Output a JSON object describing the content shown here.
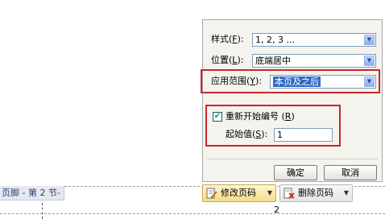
{
  "dialog": {
    "style_label": "样式",
    "style_key": "F",
    "style_value": "1, 2, 3 ...",
    "position_label": "位置",
    "position_key": "L",
    "position_value": "底端居中",
    "apply_label": "应用范围",
    "apply_key": "Y",
    "apply_value": "本页及之后",
    "restart_label": "重新开始编号",
    "restart_key": "R",
    "restart_checked": true,
    "start_label": "起始值",
    "start_key": "S",
    "start_value": "1",
    "ok_label": "确定",
    "cancel_label": "取消"
  },
  "toolbar": {
    "modify_label": "修改页码",
    "delete_label": "删除页码"
  },
  "document": {
    "footer_tag": "页脚 - 第 2 节-",
    "page_number": "2"
  },
  "colors": {
    "highlight_box": "#c62828",
    "selection": "#316ac5",
    "check": "#21a121"
  }
}
